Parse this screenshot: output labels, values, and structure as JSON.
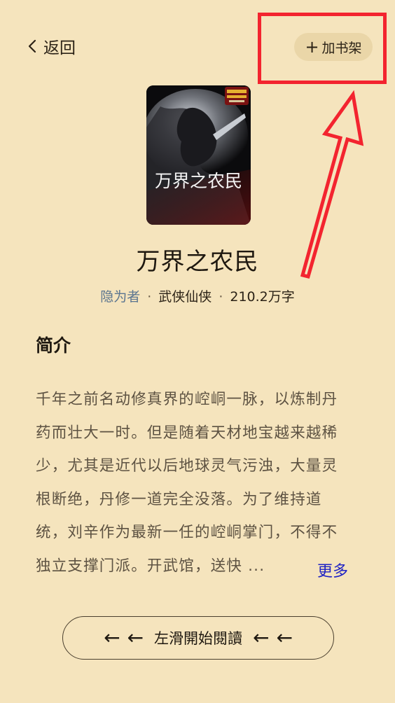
{
  "header": {
    "back_label": "返回",
    "add_shelf_label": "加书架",
    "add_shelf_icon": "+"
  },
  "book": {
    "cover_title": "万界之农民",
    "title": "万界之农民",
    "author": "隐为者",
    "category": "武侠仙侠",
    "word_count": "210.2万字",
    "separator": "·"
  },
  "intro": {
    "heading": "简介",
    "lines": [
      "千年之前名动修真界的崆峒一脉，以炼制丹",
      "药而壮大一时。但是随着天材地宝越来越稀",
      "少，尤其是近代以后地球灵气污浊，大量灵",
      "根断绝，丹修一道完全没落。为了维持道",
      "统，刘辛作为最新一任的崆峒掌门，不得不",
      "独立支撑门派。开武馆，送快 ..."
    ],
    "more_label": "更多"
  },
  "swipe": {
    "label": "左滑開始閱讀",
    "arrow": "←"
  },
  "colors": {
    "background": "#f5e4bd",
    "annotation": "#f3242f",
    "link": "#1f22c4",
    "author": "#5b7590"
  }
}
